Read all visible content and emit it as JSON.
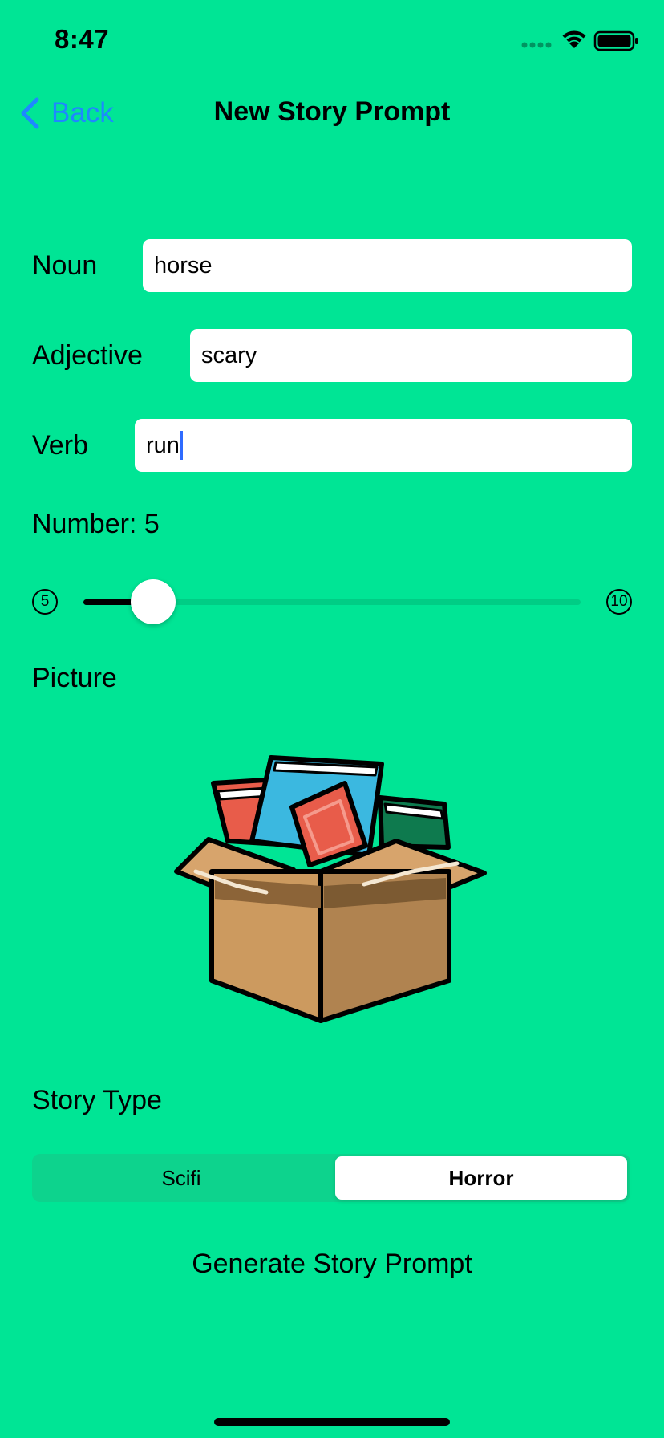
{
  "status_bar": {
    "time": "8:47",
    "icons": [
      "signal-dots-icon",
      "wifi-icon",
      "battery-icon"
    ]
  },
  "nav": {
    "back_label": "Back",
    "title": "New Story Prompt"
  },
  "form": {
    "noun": {
      "label": "Noun",
      "value": "horse"
    },
    "adjective": {
      "label": "Adjective",
      "value": "scary"
    },
    "verb": {
      "label": "Verb",
      "value": "run"
    },
    "number": {
      "label": "Number: 5",
      "value": 5,
      "min": 5,
      "max": 10,
      "min_label": "5",
      "max_label": "10",
      "fill_fraction": 0.14
    },
    "picture": {
      "label": "Picture",
      "image": "box-of-books-illustration"
    },
    "story_type": {
      "label": "Story Type",
      "options": [
        "Scifi",
        "Horror"
      ],
      "selected": "Horror"
    }
  },
  "actions": {
    "generate_label": "Generate Story Prompt"
  },
  "colors": {
    "background": "#00E595",
    "accent": "#1E88FF",
    "segmented_bg": "#0DD38D"
  }
}
